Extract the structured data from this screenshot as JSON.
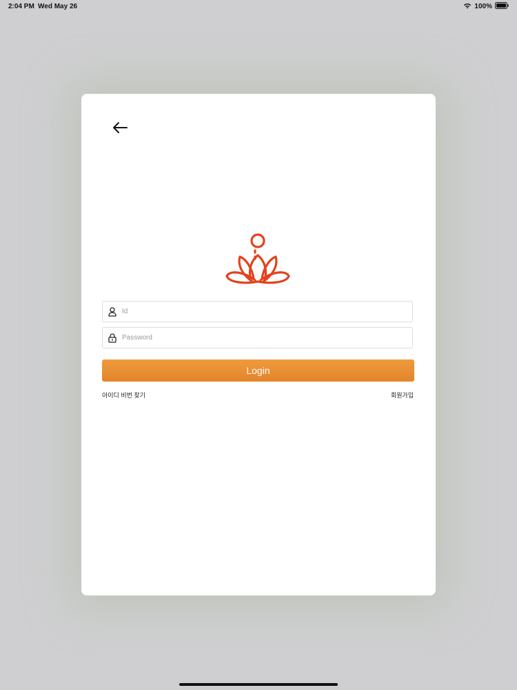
{
  "status_bar": {
    "time": "2:04 PM",
    "date": "Wed May 26",
    "battery": "100%"
  },
  "icons": {
    "back": "arrow-left-icon",
    "logo": "meditation-lotus-logo",
    "user": "user-icon",
    "lock": "lock-icon",
    "wifi": "wifi-icon",
    "battery": "battery-icon"
  },
  "colors": {
    "accent": "#e98a30",
    "logo": "#e3421d",
    "background": "#cfcfd1",
    "modal": "#ffffff"
  },
  "login_form": {
    "id_placeholder": "Id",
    "password_placeholder": "Password",
    "login_label": "Login",
    "find_account_label": "아이디 비번 찾기",
    "signup_label": "회원가입"
  }
}
